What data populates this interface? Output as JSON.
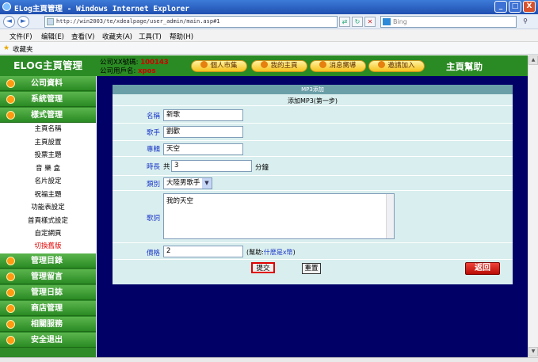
{
  "window": {
    "title": "ELog主頁管理 - Windows Internet Explorer",
    "min": "_",
    "max": "□",
    "close": "X"
  },
  "browser": {
    "url": "http://win2003/te/xdealpage/user_admin/main.asp#1",
    "search_placeholder": "Bing",
    "back_icon": "◄",
    "forward_icon": "►",
    "refresh_icon": "↻",
    "stop_icon": "✕",
    "go_icon": "⇄"
  },
  "menu": {
    "items": [
      "文件(F)",
      "编辑(E)",
      "查看(V)",
      "收藏夹(A)",
      "工具(T)",
      "帮助(H)"
    ]
  },
  "favorites": {
    "label": "收藏夹"
  },
  "header": {
    "brand": "ELOG主頁管理",
    "account_label": "公司XX號碼:",
    "account_value": "100143",
    "user_label": "公司用戶名:",
    "user_value": "xpos",
    "nav": [
      "個人市集",
      "我的主頁",
      "消息嚮導",
      "邀請加入"
    ],
    "help": "主頁幫助"
  },
  "sidebar": {
    "sections_top": [
      "公司資料",
      "系統管理",
      "樣式管理"
    ],
    "subitems": [
      "主頁名稱",
      "主頁設置",
      "投票主題",
      "音 樂 盒",
      "名片設定",
      "祝福主題",
      "功能表設定",
      "首頁樣式設定",
      "自定網頁",
      "切換舊版"
    ],
    "active_subitem": "切換舊版",
    "sections_bottom": [
      "管理目錄",
      "管理留言",
      "管理日誌",
      "商店管理",
      "相關服務",
      "安全退出"
    ]
  },
  "form": {
    "header": "MP3添加",
    "subheader": "添加MP3(第一步)",
    "name_label": "名稱",
    "name_value": "新歌",
    "singer_label": "歌手",
    "singer_value": "劉歡",
    "album_label": "專輯",
    "album_value": "天空",
    "duration_label": "時長",
    "duration_prefix": "共",
    "duration_value": "3",
    "duration_unit": "分鐘",
    "category_label": "類別",
    "category_value": "大陸男歌手",
    "lyrics_label": "歌詞",
    "lyrics_value": "我的天空",
    "price_label": "價格",
    "price_value": "2",
    "help_prefix": "(幫助:",
    "help_link": "什麽是x幣",
    "help_suffix": ")",
    "submit": "提交",
    "reset": "重置",
    "back": "返回"
  },
  "colors": {
    "sidebar_green": "#2f8a28",
    "content_navy": "#000066",
    "panel": "#d9eeee",
    "label_blue": "#1a37c8",
    "alert_red": "#e00000"
  }
}
